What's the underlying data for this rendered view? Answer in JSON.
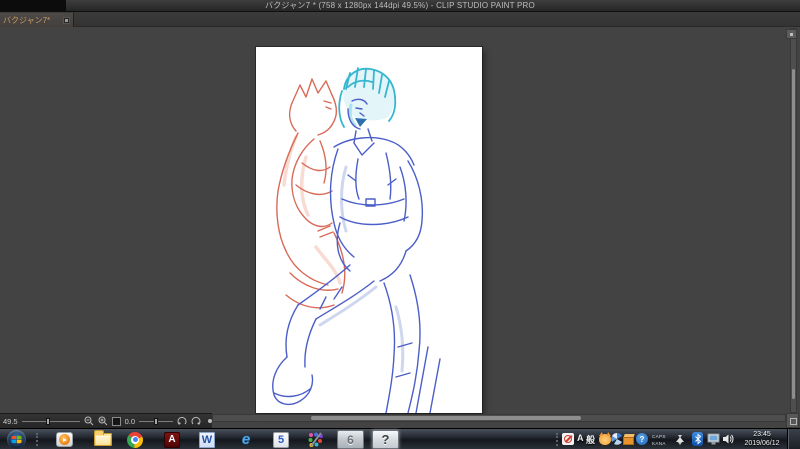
{
  "app": {
    "name": "CLIP STUDIO PAINT PRO"
  },
  "title_bar": {
    "title": "バクジャン7 * (758 x 1280px 144dpi 49.5%)  - CLIP STUDIO PAINT PRO"
  },
  "tab_bar": {
    "active_tab_label": "バクジャン7*"
  },
  "canvas": {
    "content": "rough sketch of two seated figures",
    "sketch_colors": {
      "coral": "#d96a58",
      "blue": "#4b5ec9",
      "teal": "#35b7cf"
    }
  },
  "status_bar": {
    "zoom_value": "49.5",
    "rotation_value": "0.0"
  },
  "taskbar": {
    "apps": {
      "five_label": "5",
      "acrobat_label": "A",
      "word_label": "W",
      "ie_label": "e",
      "six_label": "6",
      "clip_label": "?"
    },
    "tray": {
      "ime_alpha_label": "A",
      "ime_mode_label": "般",
      "help_label": "?",
      "caps_label": "CAPS",
      "kana_label": "KANA"
    },
    "clock": {
      "time": "23:45",
      "date": "2019/06/12"
    }
  }
}
